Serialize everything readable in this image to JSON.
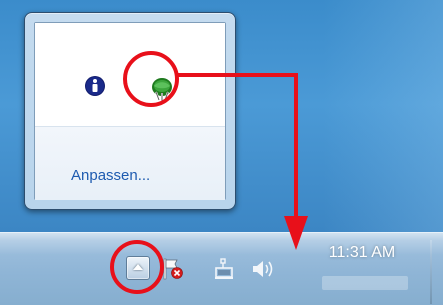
{
  "flyout": {
    "customize_label": "Anpassen..."
  },
  "flyout_icons": [
    {
      "name": "info-icon",
      "interactable": true
    },
    {
      "name": "green-app-icon",
      "interactable": true
    }
  ],
  "tray": {
    "expand_button_icon": "chevron-up-icon",
    "icons": [
      "action-center-flag-icon",
      "network-icon",
      "volume-icon"
    ],
    "clock_time": "11:31 AM"
  },
  "annotations": {
    "highlight_color": "#e8101a"
  }
}
